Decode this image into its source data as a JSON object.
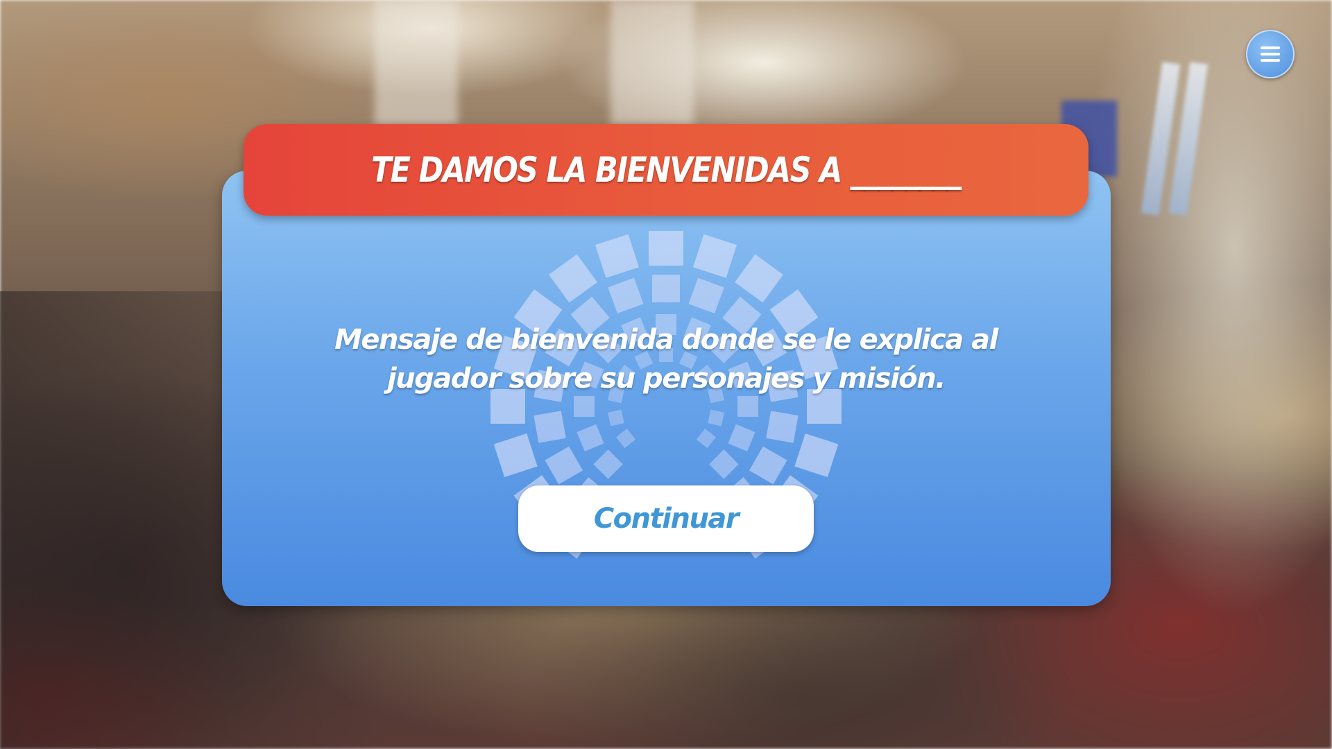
{
  "background": {
    "description_icon": "parliament-chamber-background"
  },
  "menu": {
    "icon": "hamburger-menu-icon"
  },
  "dialog": {
    "title": "TE DAMOS LA BIENVENIDAS A ________",
    "message": "Mensaje de bienvenida donde se le explica al jugador sobre su personajes y misión.",
    "continue_label": "Continuar",
    "emblem_icon": "tiled-circle-emblem-icon"
  },
  "colors": {
    "header_red": "#e5443a",
    "dialog_blue_top": "#8fc3f2",
    "dialog_blue_bottom": "#4a8ae0",
    "button_text_blue": "#3f97d6",
    "white": "#ffffff"
  }
}
